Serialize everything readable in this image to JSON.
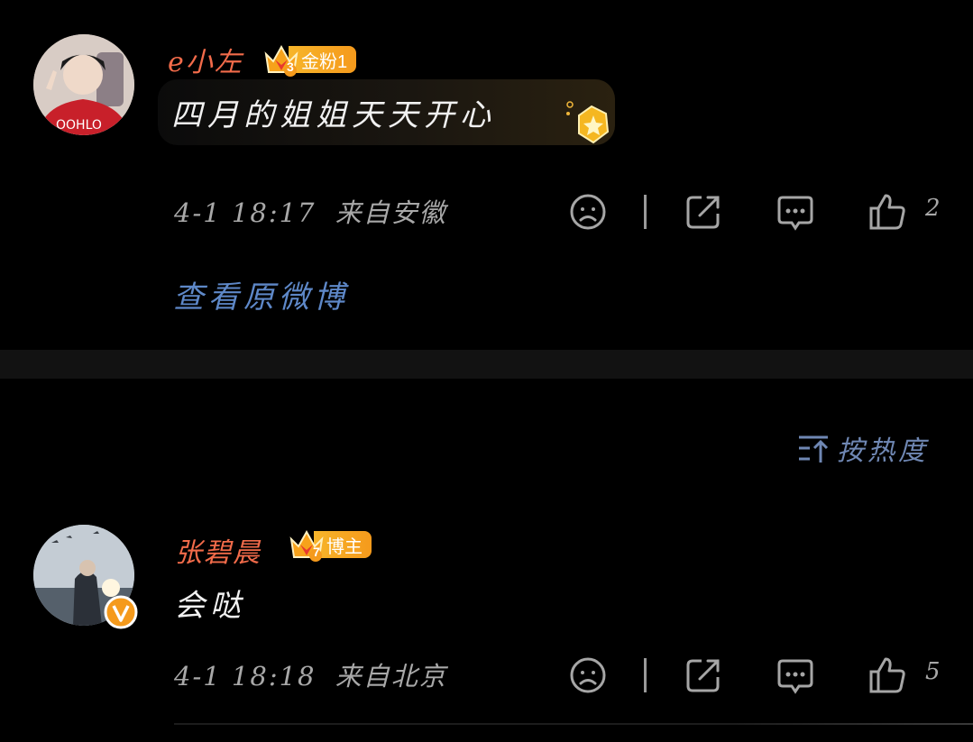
{
  "comments": [
    {
      "username": "e小左",
      "badge": {
        "level": "3",
        "label": "金粉1"
      },
      "text": "四月的姐姐天天开心",
      "timestamp": "4-1 18:17",
      "location": "来自安徽",
      "likes": "2"
    },
    {
      "username": "张碧晨",
      "badge": {
        "level": "7",
        "label": "博主"
      },
      "text": "会哒",
      "timestamp": "4-1 18:18",
      "location": "来自北京",
      "likes": "5"
    }
  ],
  "view_original_label": "查看原微博",
  "sort_label": "按热度",
  "colors": {
    "username": "#f26b4a",
    "link": "#5e88c8",
    "badge": "#f7b52a",
    "background": "#000000"
  },
  "icons": [
    "sad-face-icon",
    "share-icon",
    "comment-icon",
    "thumbs-up-icon",
    "sort-icon",
    "verified-icon",
    "crown-icon"
  ]
}
